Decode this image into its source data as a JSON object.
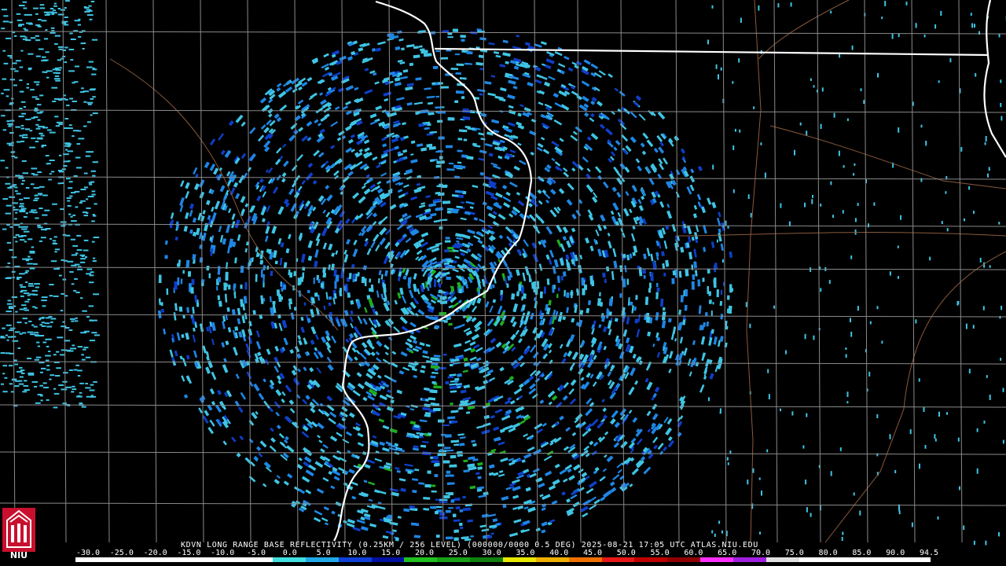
{
  "product_title": "KDVN LONG RANGE BASE REFLECTIVITY (0.25KM / 256 LEVEL) (000000/0000 0.5 DEG) 2025-08-21 17:05 UTC  ATLAS.NIU.EDU",
  "logo": {
    "text": "NIU",
    "icon": "niu-seal-icon",
    "color": "#c8102e"
  },
  "colorbar": {
    "ticks": [
      "-30.0",
      "-25.0",
      "-20.0",
      "-15.0",
      "-10.0",
      "-5.0",
      "0.0",
      "5.0",
      "10.0",
      "15.0",
      "20.0",
      "25.0",
      "30.0",
      "35.0",
      "40.0",
      "45.0",
      "50.0",
      "55.0",
      "60.0",
      "65.0",
      "70.0",
      "75.0",
      "80.0",
      "85.0",
      "90.0",
      "94.5"
    ],
    "colors": [
      "#ffffff",
      "#ffffff",
      "#ffffff",
      "#ffffff",
      "#ffffff",
      "#ffffff",
      "#40e0e0",
      "#20a8e8",
      "#1040d8",
      "#0010a0",
      "#20c020",
      "#18a018",
      "#108010",
      "#e8e800",
      "#f0b000",
      "#f07000",
      "#e81818",
      "#c00000",
      "#900000",
      "#ff30ff",
      "#a020e0",
      "#e0e0e0",
      "#ffffff",
      "#ffffff",
      "#ffffff",
      "#ffffff"
    ]
  },
  "radar": {
    "site": "KDVN"
  },
  "colors": {
    "state_border": "#ffffff",
    "county_line": "#8a8a8a",
    "highway": "#8b5a3c",
    "echo_light": "#3fc4e4",
    "echo_mid": "#1e86e4",
    "echo_dark": "#0f3fc8",
    "echo_green": "#1fae1f"
  }
}
